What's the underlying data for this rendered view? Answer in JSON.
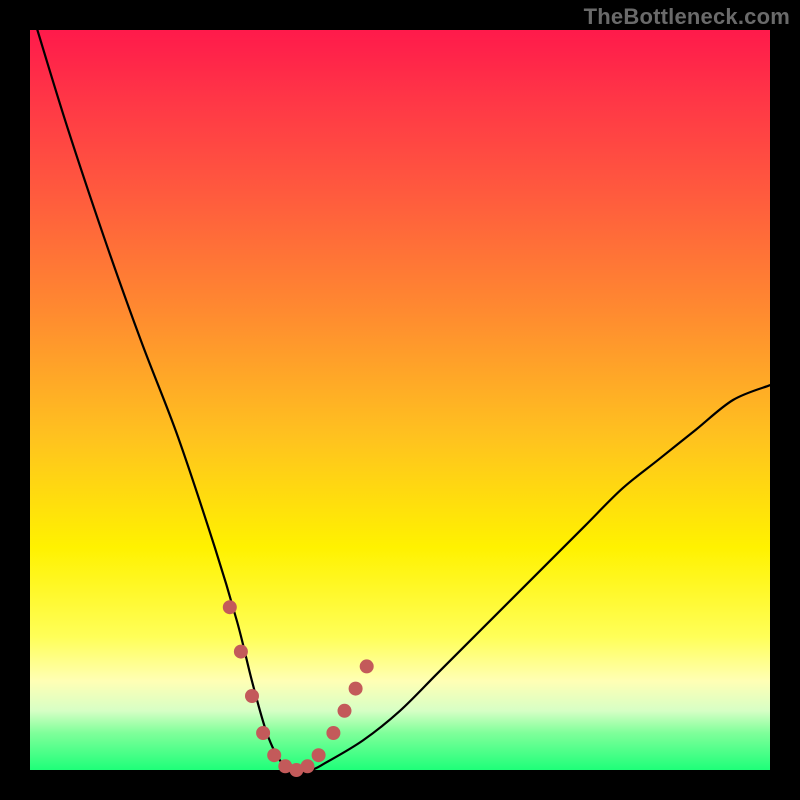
{
  "watermark": "TheBottleneck.com",
  "chart_data": {
    "type": "line",
    "title": "",
    "xlabel": "",
    "ylabel": "",
    "xlim": [
      0,
      100
    ],
    "ylim": [
      0,
      100
    ],
    "gradient": {
      "top_color": "#ff1a4b",
      "mid_color": "#fff200",
      "bottom_color": "#1eff79"
    },
    "series": [
      {
        "name": "bottleneck-curve",
        "x": [
          1,
          5,
          10,
          15,
          20,
          25,
          28,
          30,
          32,
          34,
          36,
          38,
          40,
          45,
          50,
          55,
          60,
          65,
          70,
          75,
          80,
          85,
          90,
          95,
          100
        ],
        "y": [
          100,
          87,
          72,
          58,
          45,
          30,
          20,
          12,
          5,
          1,
          0,
          0,
          1,
          4,
          8,
          13,
          18,
          23,
          28,
          33,
          38,
          42,
          46,
          50,
          52
        ]
      }
    ],
    "markers": {
      "name": "highlight-dots",
      "color": "#c35a5a",
      "x": [
        27,
        28.5,
        30,
        31.5,
        33,
        34.5,
        36,
        37.5,
        39,
        41,
        42.5,
        44,
        45.5
      ],
      "y": [
        22,
        16,
        10,
        5,
        2,
        0.5,
        0,
        0.5,
        2,
        5,
        8,
        11,
        14
      ]
    }
  }
}
